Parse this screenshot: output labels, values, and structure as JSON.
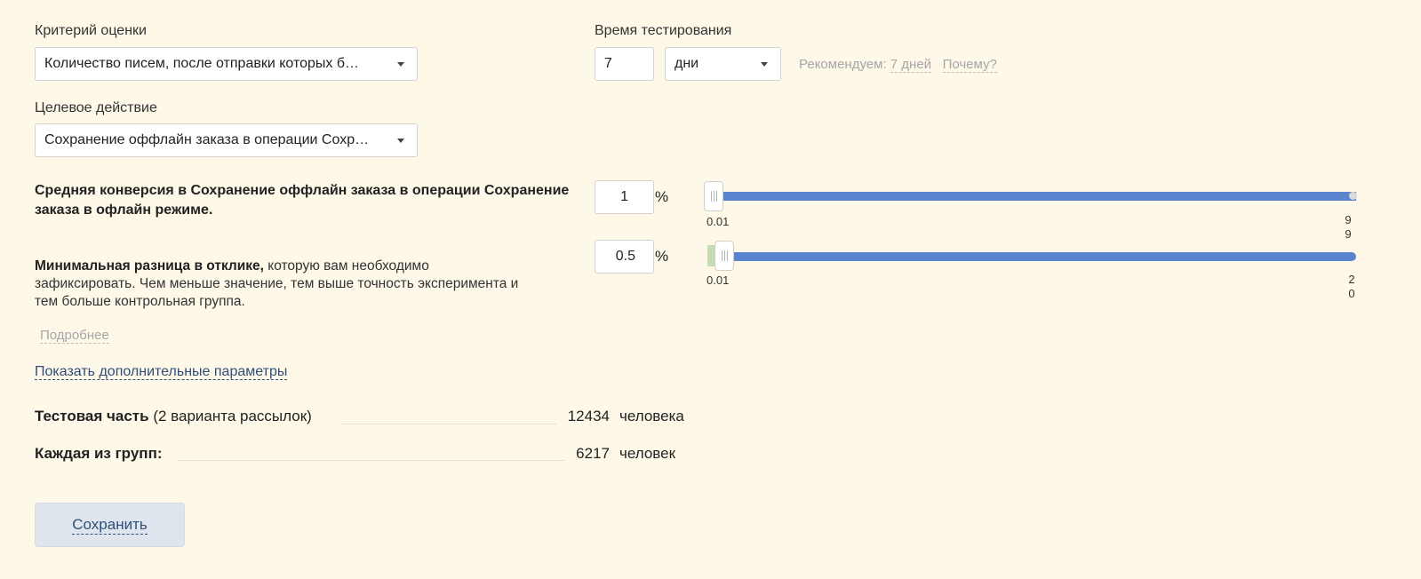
{
  "criterion": {
    "label": "Критерий оценки",
    "value": "Количество писем, после отправки которых б…"
  },
  "target_action": {
    "label": "Целевое действие",
    "value": "Сохранение оффлайн заказа в операции Сохр…"
  },
  "test_time": {
    "label": "Время тестирования",
    "value": "7",
    "unit": "дни",
    "recommend_prefix": "Рекомендуем:",
    "recommend_link": "7 дней",
    "why_link": "Почему?"
  },
  "avg_conversion": {
    "label_line1": "Средняя конверсия в Сохранение оффлайн заказа в операции Сохранение",
    "label_line2": "заказа в офлайн режиме.",
    "value": "1",
    "unit": "%",
    "slider_min_label": "0.01",
    "slider_max_label_1": "9",
    "slider_max_label_2": "9",
    "slider_fraction": 0.0
  },
  "min_diff": {
    "label_bold": "Минимальная разница в отклике,",
    "label_rest_1": " которую вам необходимо",
    "label_line2": "зафиксировать. Чем меньше значение, тем выше точность эксперимента и",
    "label_line3": "тем больше контрольная группа.",
    "value": "0.5",
    "unit": "%",
    "slider_min_label": "0.01",
    "slider_max_label_1": "2",
    "slider_max_label_2": "0",
    "slider_fraction": 0.02
  },
  "more_link": "Подробнее",
  "extra_params_link": "Показать дополнительные параметры",
  "summary": {
    "test_part_bold": "Тестовая часть",
    "test_part_rest": " (2 варианта рассылок)",
    "test_part_count": "12434",
    "test_part_unit": "человека",
    "each_group_bold": "Каждая из групп:",
    "each_group_count": "6217",
    "each_group_unit": "человек"
  },
  "save_button": "Сохранить",
  "colors": {
    "background": "#fdf8e8",
    "slider_track": "#5b84cf",
    "link": "#2f4f7a"
  }
}
